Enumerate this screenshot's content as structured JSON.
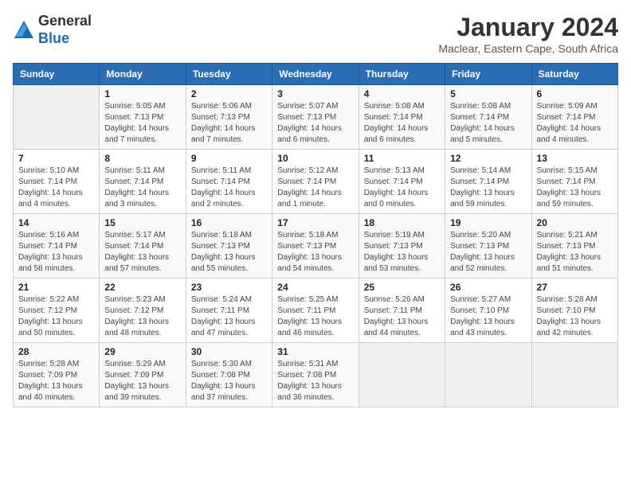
{
  "logo": {
    "general": "General",
    "blue": "Blue"
  },
  "title": "January 2024",
  "subtitle": "Maclear, Eastern Cape, South Africa",
  "headers": [
    "Sunday",
    "Monday",
    "Tuesday",
    "Wednesday",
    "Thursday",
    "Friday",
    "Saturday"
  ],
  "weeks": [
    [
      {
        "day": "",
        "info": ""
      },
      {
        "day": "1",
        "info": "Sunrise: 5:05 AM\nSunset: 7:13 PM\nDaylight: 14 hours\nand 7 minutes."
      },
      {
        "day": "2",
        "info": "Sunrise: 5:06 AM\nSunset: 7:13 PM\nDaylight: 14 hours\nand 7 minutes."
      },
      {
        "day": "3",
        "info": "Sunrise: 5:07 AM\nSunset: 7:13 PM\nDaylight: 14 hours\nand 6 minutes."
      },
      {
        "day": "4",
        "info": "Sunrise: 5:08 AM\nSunset: 7:14 PM\nDaylight: 14 hours\nand 6 minutes."
      },
      {
        "day": "5",
        "info": "Sunrise: 5:08 AM\nSunset: 7:14 PM\nDaylight: 14 hours\nand 5 minutes."
      },
      {
        "day": "6",
        "info": "Sunrise: 5:09 AM\nSunset: 7:14 PM\nDaylight: 14 hours\nand 4 minutes."
      }
    ],
    [
      {
        "day": "7",
        "info": "Sunrise: 5:10 AM\nSunset: 7:14 PM\nDaylight: 14 hours\nand 4 minutes."
      },
      {
        "day": "8",
        "info": "Sunrise: 5:11 AM\nSunset: 7:14 PM\nDaylight: 14 hours\nand 3 minutes."
      },
      {
        "day": "9",
        "info": "Sunrise: 5:11 AM\nSunset: 7:14 PM\nDaylight: 14 hours\nand 2 minutes."
      },
      {
        "day": "10",
        "info": "Sunrise: 5:12 AM\nSunset: 7:14 PM\nDaylight: 14 hours\nand 1 minute."
      },
      {
        "day": "11",
        "info": "Sunrise: 5:13 AM\nSunset: 7:14 PM\nDaylight: 14 hours\nand 0 minutes."
      },
      {
        "day": "12",
        "info": "Sunrise: 5:14 AM\nSunset: 7:14 PM\nDaylight: 13 hours\nand 59 minutes."
      },
      {
        "day": "13",
        "info": "Sunrise: 5:15 AM\nSunset: 7:14 PM\nDaylight: 13 hours\nand 59 minutes."
      }
    ],
    [
      {
        "day": "14",
        "info": "Sunrise: 5:16 AM\nSunset: 7:14 PM\nDaylight: 13 hours\nand 58 minutes."
      },
      {
        "day": "15",
        "info": "Sunrise: 5:17 AM\nSunset: 7:14 PM\nDaylight: 13 hours\nand 57 minutes."
      },
      {
        "day": "16",
        "info": "Sunrise: 5:18 AM\nSunset: 7:13 PM\nDaylight: 13 hours\nand 55 minutes."
      },
      {
        "day": "17",
        "info": "Sunrise: 5:18 AM\nSunset: 7:13 PM\nDaylight: 13 hours\nand 54 minutes."
      },
      {
        "day": "18",
        "info": "Sunrise: 5:19 AM\nSunset: 7:13 PM\nDaylight: 13 hours\nand 53 minutes."
      },
      {
        "day": "19",
        "info": "Sunrise: 5:20 AM\nSunset: 7:13 PM\nDaylight: 13 hours\nand 52 minutes."
      },
      {
        "day": "20",
        "info": "Sunrise: 5:21 AM\nSunset: 7:13 PM\nDaylight: 13 hours\nand 51 minutes."
      }
    ],
    [
      {
        "day": "21",
        "info": "Sunrise: 5:22 AM\nSunset: 7:12 PM\nDaylight: 13 hours\nand 50 minutes."
      },
      {
        "day": "22",
        "info": "Sunrise: 5:23 AM\nSunset: 7:12 PM\nDaylight: 13 hours\nand 48 minutes."
      },
      {
        "day": "23",
        "info": "Sunrise: 5:24 AM\nSunset: 7:11 PM\nDaylight: 13 hours\nand 47 minutes."
      },
      {
        "day": "24",
        "info": "Sunrise: 5:25 AM\nSunset: 7:11 PM\nDaylight: 13 hours\nand 46 minutes."
      },
      {
        "day": "25",
        "info": "Sunrise: 5:26 AM\nSunset: 7:11 PM\nDaylight: 13 hours\nand 44 minutes."
      },
      {
        "day": "26",
        "info": "Sunrise: 5:27 AM\nSunset: 7:10 PM\nDaylight: 13 hours\nand 43 minutes."
      },
      {
        "day": "27",
        "info": "Sunrise: 5:28 AM\nSunset: 7:10 PM\nDaylight: 13 hours\nand 42 minutes."
      }
    ],
    [
      {
        "day": "28",
        "info": "Sunrise: 5:28 AM\nSunset: 7:09 PM\nDaylight: 13 hours\nand 40 minutes."
      },
      {
        "day": "29",
        "info": "Sunrise: 5:29 AM\nSunset: 7:09 PM\nDaylight: 13 hours\nand 39 minutes."
      },
      {
        "day": "30",
        "info": "Sunrise: 5:30 AM\nSunset: 7:08 PM\nDaylight: 13 hours\nand 37 minutes."
      },
      {
        "day": "31",
        "info": "Sunrise: 5:31 AM\nSunset: 7:08 PM\nDaylight: 13 hours\nand 36 minutes."
      },
      {
        "day": "",
        "info": ""
      },
      {
        "day": "",
        "info": ""
      },
      {
        "day": "",
        "info": ""
      }
    ]
  ]
}
